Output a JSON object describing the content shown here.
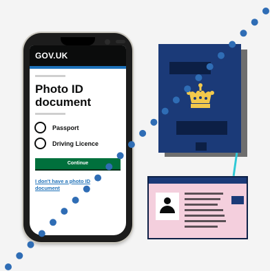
{
  "phone": {
    "header_title": "GOV.UK",
    "page_title": "Photo ID document",
    "options": [
      {
        "label": "Passport"
      },
      {
        "label": "Driving Licence"
      }
    ],
    "continue_label": "Continue",
    "no_id_link": "I don't have a photo ID document"
  },
  "icons": {
    "passport": "passport-icon",
    "crown": "crown-icon",
    "id_card": "id-card-icon",
    "person": "person-icon"
  },
  "colors": {
    "gov_header": "#0b0c0c",
    "gov_blue": "#1d70b8",
    "continue_green": "#00703c",
    "passport_blue": "#1b3a78",
    "crown_gold": "#f2c94c",
    "id_card_pink": "#f4cfdd",
    "dotted_line": "#2f6db5",
    "connector": "#2fc9d6"
  }
}
